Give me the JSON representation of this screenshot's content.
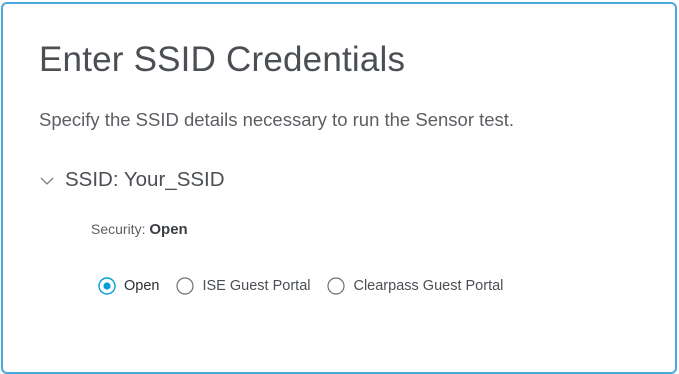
{
  "dialog": {
    "title": "Enter SSID Credentials",
    "description": "Specify the SSID details necessary to run the Sensor test."
  },
  "ssid_section": {
    "header": "SSID: Your_SSID",
    "expand_icon": "chevron-down-icon",
    "security_label": "Security:",
    "security_value": "Open"
  },
  "auth_options": {
    "selected": "Open",
    "options": [
      {
        "label": "Open",
        "selected": true
      },
      {
        "label": "ISE Guest Portal",
        "selected": false
      },
      {
        "label": "Clearpass Guest Portal",
        "selected": false
      }
    ]
  },
  "colors": {
    "accent": "#049fd9",
    "border": "#4aa8dc",
    "text": "#4b4f54"
  }
}
